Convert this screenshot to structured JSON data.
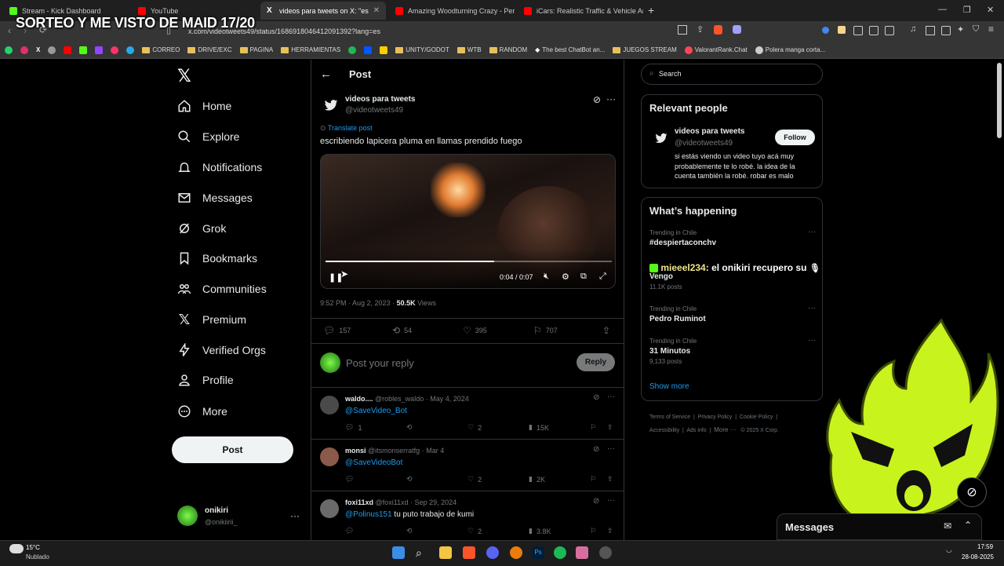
{
  "browser": {
    "tabs": [
      {
        "title": "Stream - Kick Dashboard",
        "color": "#53fc18"
      },
      {
        "title": "YouTube",
        "color": "#ff0000"
      },
      {
        "title": "videos para tweets on X: \"escribi",
        "color": "#ffffff"
      },
      {
        "title": "Amazing Woodturning Crazy - Perfe",
        "color": "#ff0000"
      },
      {
        "title": "iCars: Realistic Traffic & Vehicle Anim",
        "color": "#ff0000"
      }
    ],
    "url": "x.com/videotweets49/status/1686918046412091392?lang=es",
    "bookmarks": [
      "CORREO",
      "DRIVE/EXC",
      "PAGINA",
      "HERRAMIENTAS",
      "UNITY/GODOT",
      "WTB",
      "RANDOM",
      "The best ChatBot an...",
      "JUEGOS STREAM",
      "ValorantRank.Chat",
      "Polera manga corta..."
    ]
  },
  "stream_overlay": {
    "title": "SORTEO Y ME VISTO DE MAID 17/20",
    "chat_user": "mieeel234",
    "chat_message": ": el onikiri recupero su"
  },
  "nav": {
    "items": [
      "Home",
      "Explore",
      "Notifications",
      "Messages",
      "Grok",
      "Bookmarks",
      "Communities",
      "Premium",
      "Verified Orgs",
      "Profile",
      "More"
    ],
    "post_label": "Post",
    "account_name": "onikiri",
    "account_handle": "@onikiirii_"
  },
  "post": {
    "header": "Post",
    "author_name": "videos para tweets",
    "author_handle": "@videotweets49",
    "translate": "Translate post",
    "text": "escribiendo lapicera pluma en llamas prendido fuego",
    "video_time": "0:04 / 0:07",
    "video_progress": 0.59,
    "timestamp": "9:52 PM · Aug 2, 2023 · ",
    "views_count": "50.5K",
    "views_label": " Views",
    "replies": "157",
    "reposts": "54",
    "likes": "395",
    "bookmarks": "707",
    "reply_placeholder": "Post your reply",
    "reply_button": "Reply"
  },
  "replies": [
    {
      "name": "waldo....",
      "handle": "@robles_waldo",
      "date": "· May 4, 2024",
      "mention": "@SaveVideo_Bot",
      "text": "",
      "replies": "1",
      "reposts": "",
      "likes": "2",
      "views": "15K",
      "avatar_color": "#4a4a4a"
    },
    {
      "name": "monsi",
      "handle": "@itsmonserratfg",
      "date": "· Mar 4",
      "mention": "@SaveVideoBot",
      "text": "",
      "replies": "",
      "reposts": "",
      "likes": "2",
      "views": "2K",
      "avatar_color": "#8a5a4a"
    },
    {
      "name": "foxi11xd",
      "handle": "@foxi11xd",
      "date": "· Sep 29, 2024",
      "mention": "@Polinus151",
      "text": " tu puto trabajo de kumi",
      "replies": "",
      "reposts": "",
      "likes": "2",
      "views": "3.8K",
      "avatar_color": "#6a6a6a"
    }
  ],
  "sidebar": {
    "search_placeholder": "Search",
    "relevant_title": "Relevant people",
    "person_name": "videos para tweets",
    "person_handle": "@videotweets49",
    "follow_label": "Follow",
    "person_bio": "si estás viendo un video tuyo acá muy probablemente te lo robé. la idea de la cuenta también la robé. robar es malo",
    "happening_title": "What’s happening",
    "trends": [
      {
        "category": "Trending in Chile",
        "name": "#despiertaconchv",
        "posts": ""
      },
      {
        "category": "",
        "name": "Vengo",
        "posts": "11.1K posts"
      },
      {
        "category": "Trending in Chile",
        "name": "Pedro Ruminot",
        "posts": ""
      },
      {
        "category": "Trending in Chile",
        "name": "31 Minutos",
        "posts": "9,133 posts"
      }
    ],
    "show_more": "Show more",
    "footer_links": [
      "Terms of Service",
      "Privacy Policy",
      "Cookie Policy",
      "Accessibility",
      "Ads info",
      "More ···",
      "© 2025 X Corp."
    ]
  },
  "messages_bar": {
    "label": "Messages"
  },
  "taskbar": {
    "temp": "15°C",
    "weather": "Nublado",
    "time": "17:59",
    "date": "28-08-2025"
  },
  "colors": {
    "accent": "#1d9bf0",
    "mascot": "#c8f31d",
    "like_heart": "#71767b"
  }
}
